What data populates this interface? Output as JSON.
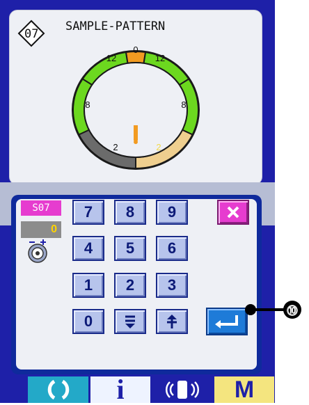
{
  "pattern": {
    "number": "07",
    "name": "SAMPLE-PATTERN"
  },
  "ring": {
    "segments": [
      {
        "label": "0",
        "color": "#f29b21"
      },
      {
        "label": "12",
        "color": "#6cd81f"
      },
      {
        "label": "12",
        "color": "#6cd81f"
      },
      {
        "label": "8",
        "color": "#6cd81f"
      },
      {
        "label": "8",
        "color": "#6cd81f"
      },
      {
        "label": "2",
        "color": "#efcf8f"
      },
      {
        "label": "2",
        "color": "#6b6b6b"
      }
    ]
  },
  "counter": {
    "code": "S07",
    "value": "0"
  },
  "keypad": {
    "keys": [
      "7",
      "8",
      "9",
      "4",
      "5",
      "6",
      "1",
      "2",
      "3",
      "0"
    ],
    "down_icon": "double-down-arrow",
    "up_icon": "plus-up-arrow",
    "enter_icon": "enter-arrow",
    "close_icon": "close-x"
  },
  "callout": {
    "number": "⓾"
  },
  "bottom_bar": {
    "info_label": "i",
    "mode_label": "M"
  },
  "colors": {
    "device": "#1e20a8",
    "key": "#b7c4ec",
    "enter": "#1e7bd8",
    "close": "#e63ccf",
    "value_text": "#ffd400"
  }
}
